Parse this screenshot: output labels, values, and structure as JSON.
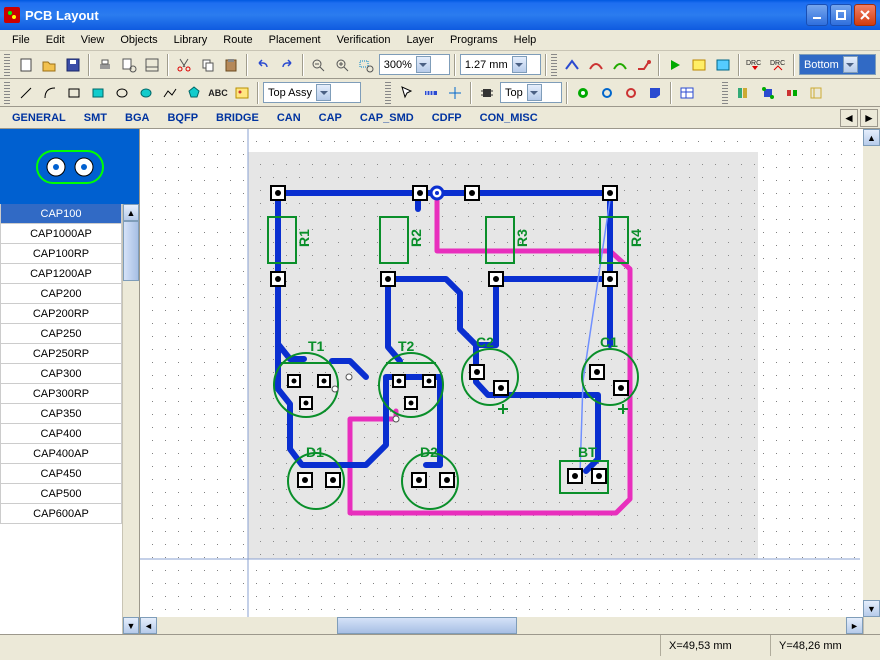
{
  "window": {
    "title": "PCB Layout"
  },
  "menu": {
    "items": [
      "File",
      "Edit",
      "View",
      "Objects",
      "Library",
      "Route",
      "Placement",
      "Verification",
      "Layer",
      "Programs",
      "Help"
    ]
  },
  "toolbar1": {
    "zoom": "300%",
    "grid": "1.27 mm",
    "layerSelect": "Bottom"
  },
  "toolbar2": {
    "layerCombo": "Top Assy",
    "sideCombo": "Top"
  },
  "categories": [
    "GENERAL",
    "SMT",
    "BGA",
    "BQFP",
    "BRIDGE",
    "CAN",
    "CAP",
    "CAP_SMD",
    "CDFP",
    "CON_MISC"
  ],
  "sidebar": {
    "items": [
      "CAP100",
      "CAP1000AP",
      "CAP100RP",
      "CAP1200AP",
      "CAP200",
      "CAP200RP",
      "CAP250",
      "CAP250RP",
      "CAP300",
      "CAP300RP",
      "CAP350",
      "CAP400",
      "CAP400AP",
      "CAP450",
      "CAP500",
      "CAP600AP"
    ],
    "selectedIndex": 0
  },
  "board": {
    "refs": {
      "R1": "R1",
      "R2": "R2",
      "R3": "R3",
      "R4": "R4",
      "T1": "T1",
      "T2": "T2",
      "C1": "C1",
      "C2": "C2",
      "D1": "D1",
      "D2": "D2",
      "BT": "BT"
    }
  },
  "status": {
    "x": "X=49,53 mm",
    "y": "Y=48,26 mm"
  },
  "colors": {
    "trace_blue": "#0a2fd0",
    "trace_pink": "#e82fbd",
    "silk_green": "#0a8f2a"
  }
}
